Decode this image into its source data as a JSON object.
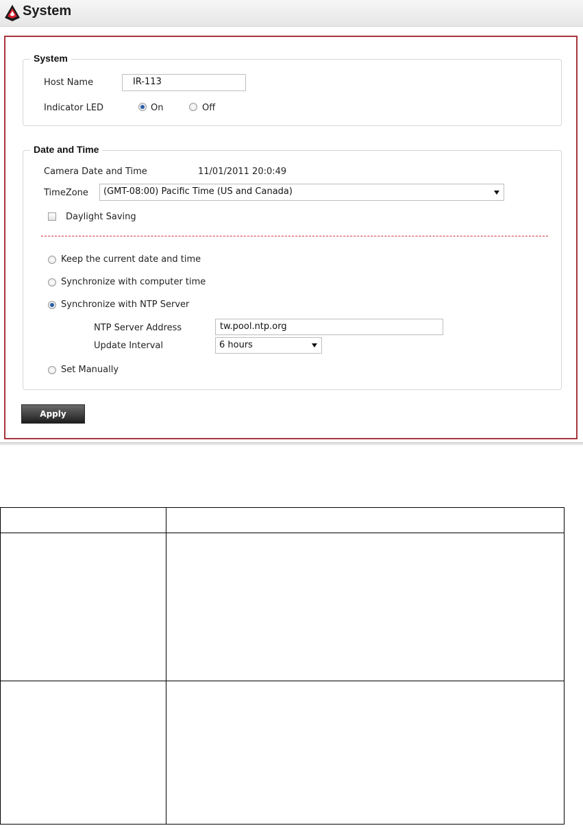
{
  "header": {
    "title": "System"
  },
  "system_section": {
    "legend": "System",
    "host_name_label": "Host Name",
    "host_name_value": "IR-113",
    "led_label": "Indicator LED",
    "led_on": "On",
    "led_off": "Off",
    "led_selected": "On"
  },
  "datetime_section": {
    "legend": "Date and Time",
    "camera_label": "Camera Date and Time",
    "camera_value": "11/01/2011 20:0:49",
    "timezone_label": "TimeZone",
    "timezone_value": "(GMT-08:00) Pacific Time (US and Canada)",
    "daylight_label": "Daylight Saving",
    "daylight_checked": false,
    "options": {
      "keep": "Keep the current date and time",
      "computer": "Synchronize with computer time",
      "ntp": "Synchronize with NTP Server",
      "manual": "Set Manually"
    },
    "selected_option": "Synchronize with NTP Server",
    "ntp_address_label": "NTP Server Address",
    "ntp_address_value": "tw.pool.ntp.org",
    "update_interval_label": "Update Interval",
    "update_interval_value": "6 hours"
  },
  "apply_label": "Apply",
  "colors": {
    "panel_border": "#a6343a",
    "divider": "#d22c3c",
    "radio_dot": "#2b5fa8"
  }
}
